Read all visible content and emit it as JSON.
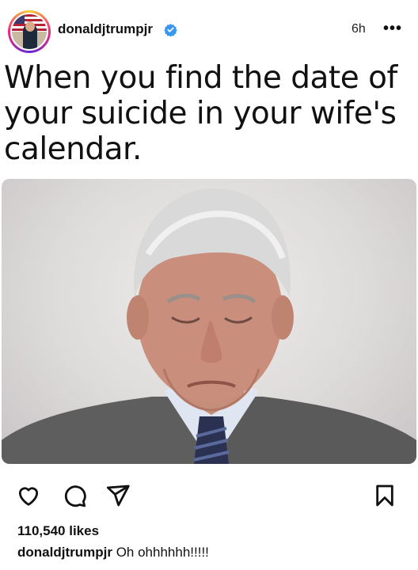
{
  "post": {
    "username": "donaldjtrumpjr",
    "verified": true,
    "time": "6h",
    "more_label": "•••",
    "meme_caption": "When you find the date of your suicide in your wife's calendar.",
    "likes": "110,540 likes",
    "comment_user": "donaldjtrumpjr",
    "comment_text": "Oh ohhhhhh!!!!!"
  },
  "icons": {
    "verified": "verified-badge-icon",
    "more": "more-options-icon",
    "like": "heart-icon",
    "comment": "comment-icon",
    "share": "share-icon",
    "save": "bookmark-icon"
  },
  "colors": {
    "verified": "#3897f0",
    "text": "#111111",
    "background": "#ffffff"
  }
}
